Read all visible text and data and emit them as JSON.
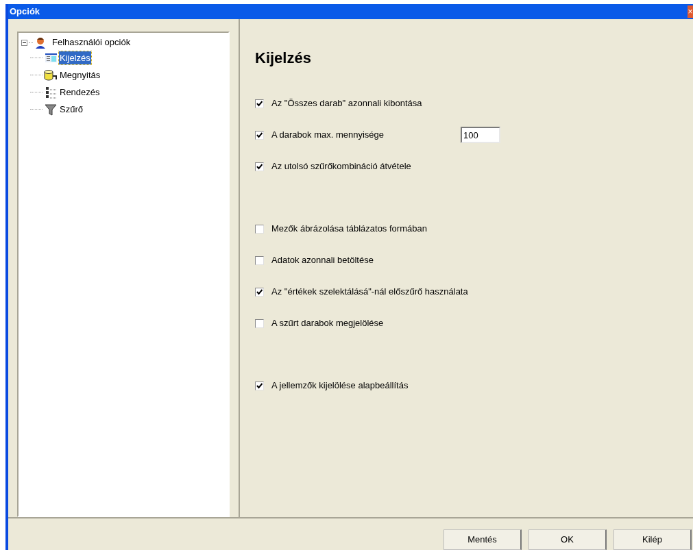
{
  "window": {
    "title": "Opciók",
    "close": "×"
  },
  "tree": {
    "label": "Felhasználói opciók",
    "expanded": true,
    "children": [
      {
        "label": "Kijelzés",
        "selected": true
      },
      {
        "label": "Megnyitás",
        "selected": false
      },
      {
        "label": "Rendezés",
        "selected": false
      },
      {
        "label": "Szűrő",
        "selected": false
      }
    ]
  },
  "heading": "Kijelzés",
  "option_groups": [
    [
      {
        "label": "Az \"Összes darab\" azonnali kibontása",
        "checked": true
      },
      {
        "label": "A darabok max. mennyisége",
        "checked": true,
        "value": "100"
      },
      {
        "label": "Az utolsó szűrőkombináció átvétele",
        "checked": true
      }
    ],
    [
      {
        "label": "Mezők ábrázolása táblázatos formában",
        "checked": false
      },
      {
        "label": "Adatok azonnali betöltése",
        "checked": false
      },
      {
        "label": "Az \"értékek szelektálásá\"-nál előszűrő használata",
        "checked": true
      },
      {
        "label": "A szűrt darabok megjelölése",
        "checked": false
      }
    ],
    [
      {
        "label": "A jellemzők kijelölése alapbeállítás",
        "checked": true
      }
    ]
  ],
  "buttons": [
    "Mentés",
    "OK",
    "Kilép"
  ]
}
